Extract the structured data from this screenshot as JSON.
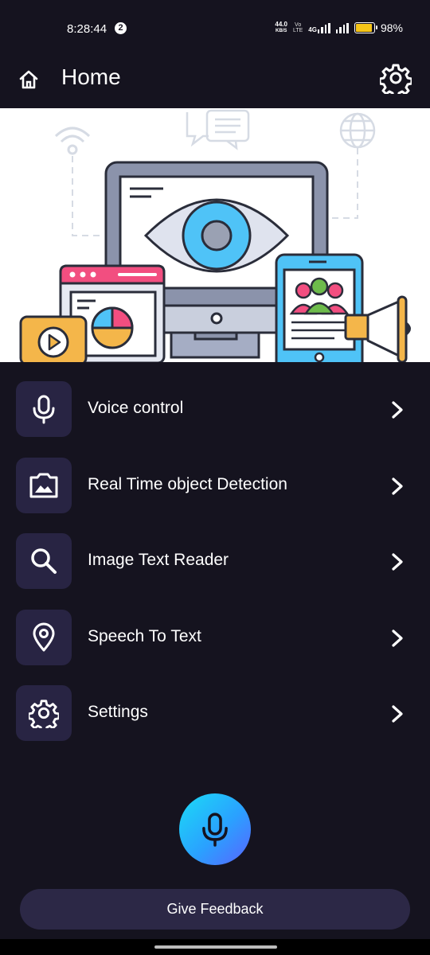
{
  "status_bar": {
    "time": "8:28:44",
    "notification_count": "2",
    "net_speed_value": "44.0",
    "net_speed_unit": "KB/S",
    "volte_top": "Vo",
    "volte_bottom": "LTE",
    "network_type": "4G",
    "battery_percent": "98%",
    "battery_level": 0.98
  },
  "app_bar": {
    "title": "Home",
    "home_icon": "home-icon",
    "settings_icon": "gear-icon"
  },
  "banner": {
    "illustration": "monitor-eye-devices-illustration"
  },
  "menu": {
    "items": [
      {
        "label": "Voice control",
        "icon": "microphone-icon"
      },
      {
        "label": "Real Time object Detection",
        "icon": "image-frame-icon"
      },
      {
        "label": "Image Text Reader",
        "icon": "search-icon"
      },
      {
        "label": "Speech To Text",
        "icon": "location-pin-icon"
      },
      {
        "label": "Settings",
        "icon": "gear-icon"
      }
    ]
  },
  "mic_button": {
    "icon": "microphone-icon"
  },
  "feedback_button": {
    "label": "Give Feedback"
  },
  "colors": {
    "background": "#15131f",
    "tile": "#282443",
    "feedback_button": "#2c2846",
    "mic_gradient_start": "#1bdcf5",
    "mic_gradient_end": "#5a63ff"
  }
}
